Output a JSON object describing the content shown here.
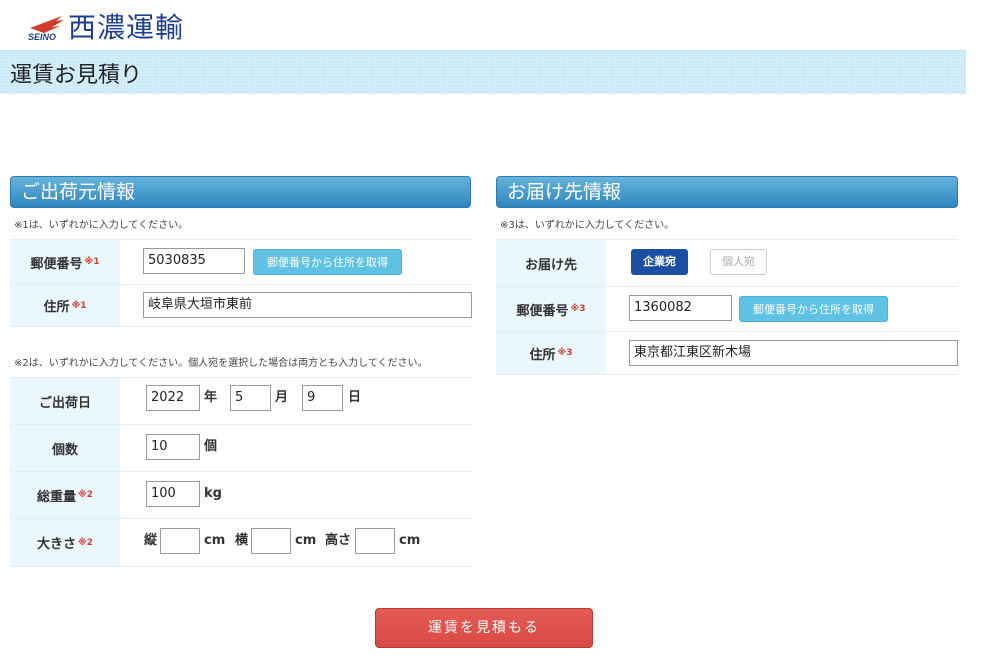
{
  "brand": {
    "sub": "SEINO",
    "name": "西濃運輸",
    "accent": "#1c3f94",
    "mark_color": "#d23a2b"
  },
  "page_title": "運賃お見積り",
  "shipper": {
    "heading": "ご出荷元情報",
    "note1": "※1は、いずれかに入力してください。",
    "postal_label": "郵便番号",
    "postal_req": "※1",
    "postal_value": "5030835",
    "postal_button": "郵便番号から住所を取得",
    "address_label": "住所",
    "address_req": "※1",
    "address_value": "岐阜県大垣市東前",
    "note2": "※2は、いずれかに入力してください。個人宛を選択した場合は両方とも入力してください。",
    "date_label": "ご出荷日",
    "date_year": "2022",
    "date_year_unit": "年",
    "date_month": "5",
    "date_month_unit": "月",
    "date_day": "9",
    "date_day_unit": "日",
    "count_label": "個数",
    "count_value": "10",
    "count_unit": "個",
    "weight_label": "総重量",
    "weight_req": "※2",
    "weight_value": "100",
    "weight_unit": "kg",
    "size_label": "大きさ",
    "size_req": "※2",
    "size_length_label": "縦",
    "size_width_label": "横",
    "size_height_label": "高さ",
    "size_unit": "cm",
    "size_length_value": "",
    "size_width_value": "",
    "size_height_value": ""
  },
  "consignee": {
    "heading": "お届け先情報",
    "note3": "※3は、いずれかに入力してください。",
    "dest_label": "お届け先",
    "corp_button": "企業宛",
    "indiv_button": "個人宛",
    "postal_label": "郵便番号",
    "postal_req": "※3",
    "postal_value": "1360082",
    "postal_button": "郵便番号から住所を取得",
    "address_label": "住所",
    "address_req": "※3",
    "address_value": "東京都江東区新木場"
  },
  "submit_label": "運賃を見積もる"
}
